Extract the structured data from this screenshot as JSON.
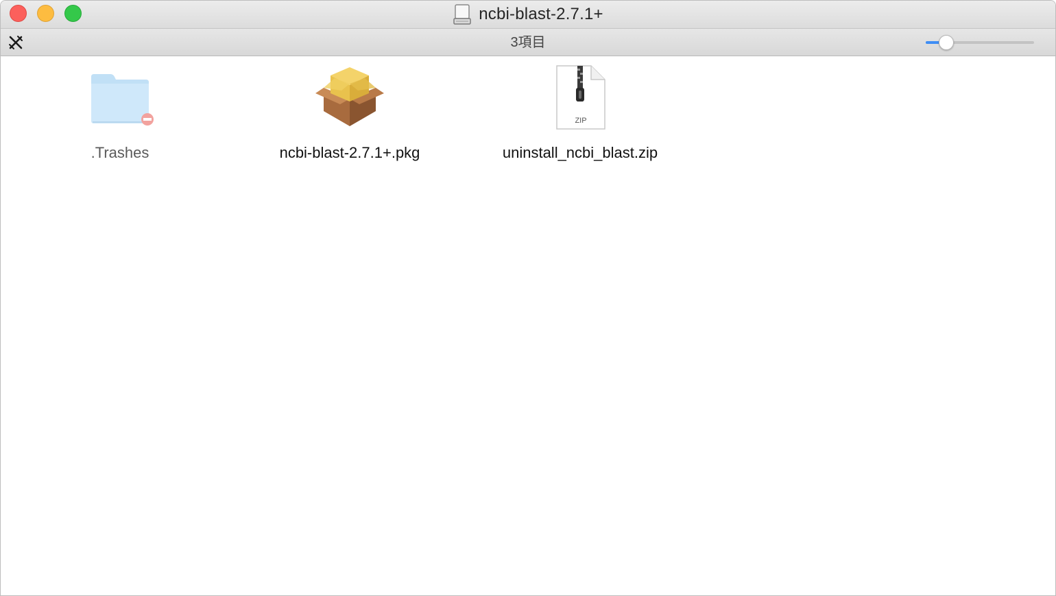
{
  "window": {
    "title": "ncbi-blast-2.7.1+",
    "title_icon": "disk-drive-icon"
  },
  "traffic_lights": {
    "close_color": "#fc605c",
    "minimize_color": "#fdbc40",
    "maximize_color": "#34c84a"
  },
  "toolbar": {
    "tool_icon": "pencil-ruler-icon",
    "item_count": "3項目",
    "icon_size_slider": {
      "value": 0.19,
      "accent_color": "#3f8ef5"
    }
  },
  "files": [
    {
      "name": ".Trashes",
      "icon": "folder-no-access-icon",
      "hidden": true
    },
    {
      "name": "ncbi-blast-2.7.1+.pkg",
      "icon": "package-icon",
      "hidden": false
    },
    {
      "name": "uninstall_ncbi_blast.zip",
      "icon": "zip-archive-icon",
      "hidden": false,
      "badge": "ZIP"
    }
  ]
}
